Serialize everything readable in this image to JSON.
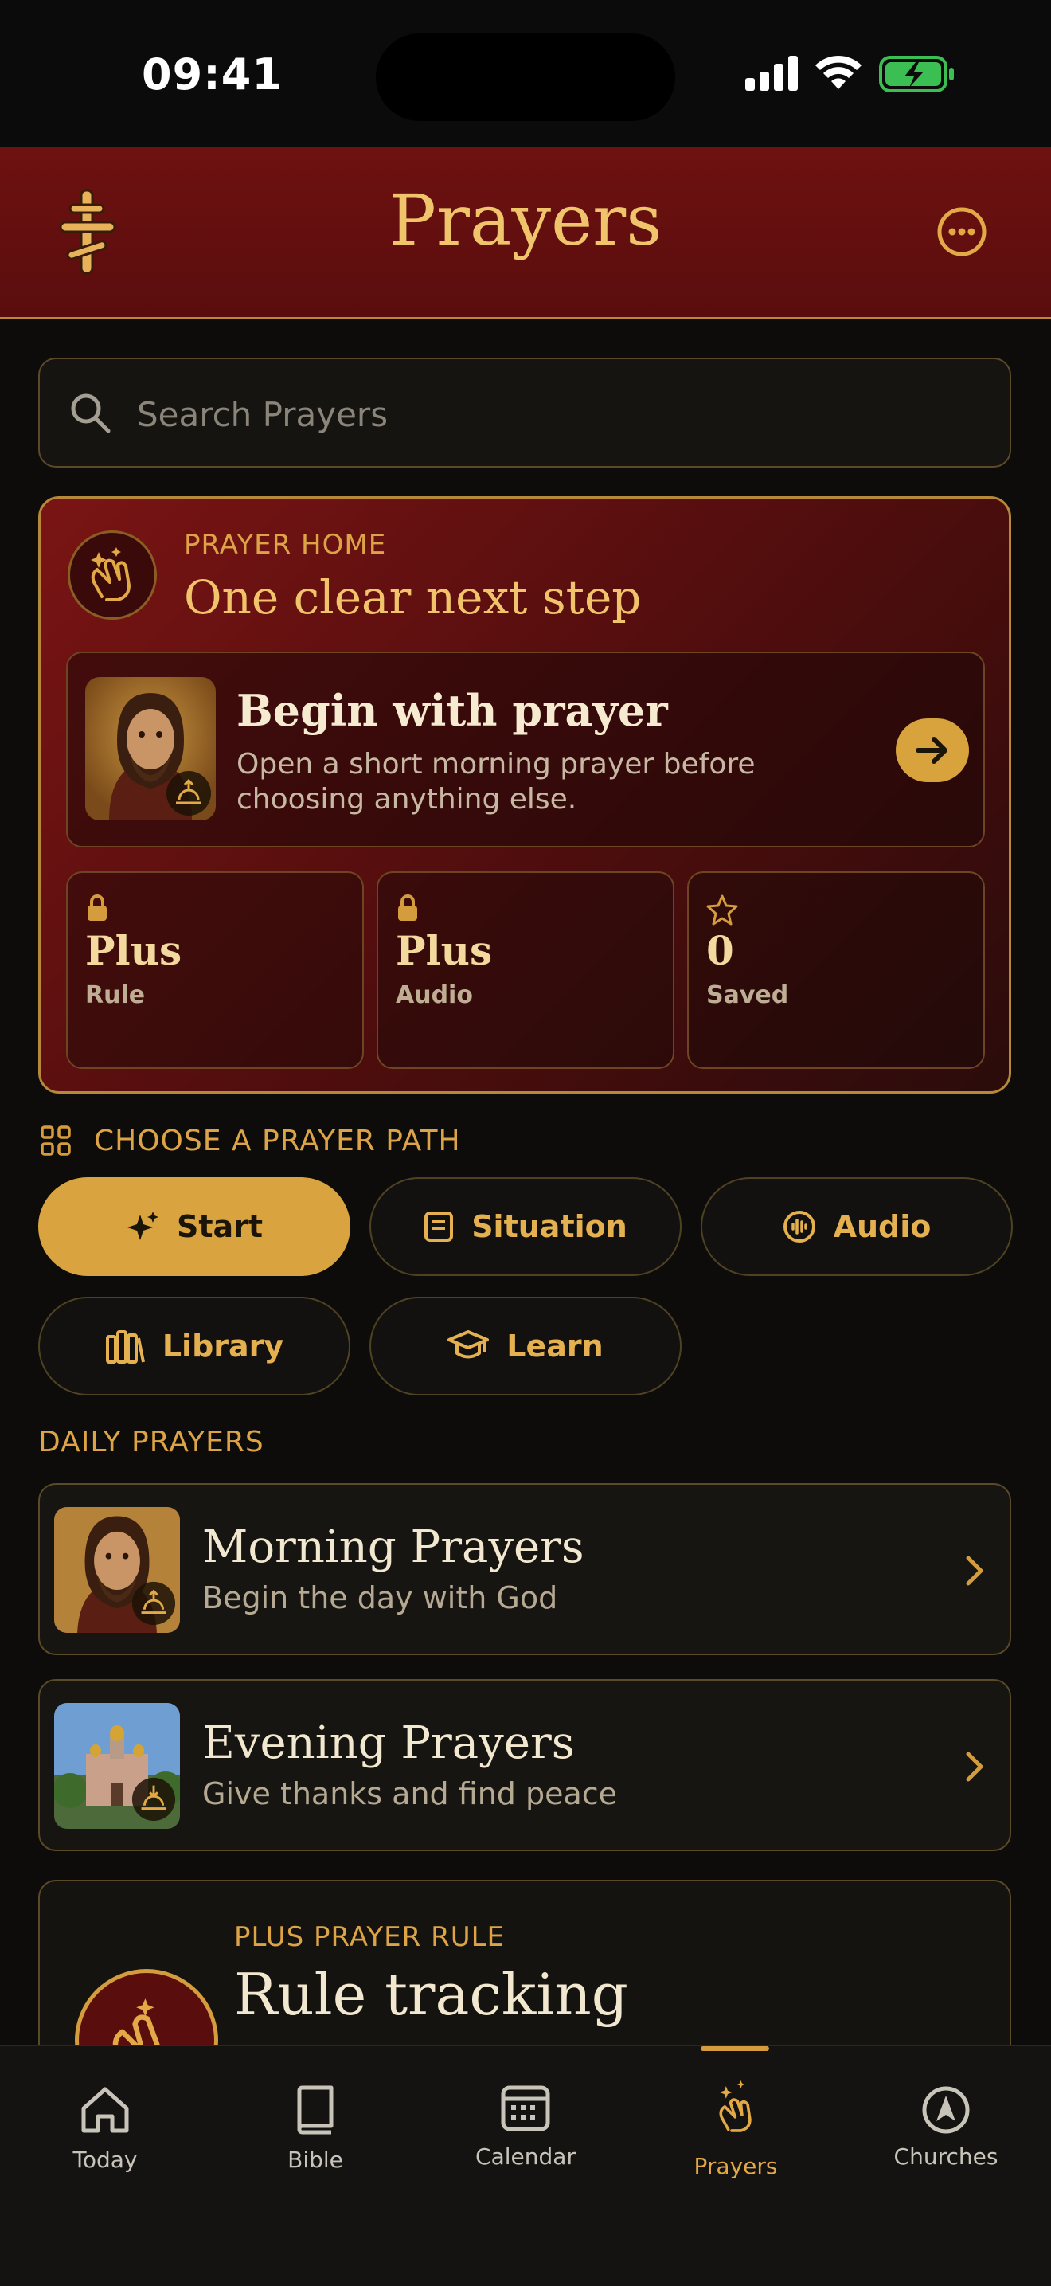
{
  "status_bar": {
    "time": "09:41"
  },
  "header": {
    "title": "Prayers"
  },
  "search": {
    "placeholder": "Search Prayers"
  },
  "prayer_home": {
    "eyebrow": "PRAYER HOME",
    "title": "One clear next step",
    "begin": {
      "title": "Begin with prayer",
      "subtitle": "Open a short morning prayer before choosing anything else."
    },
    "stats": [
      {
        "value": "Plus",
        "label": "Rule",
        "icon": "lock-icon"
      },
      {
        "value": "Plus",
        "label": "Audio",
        "icon": "lock-icon"
      },
      {
        "value": "0",
        "label": "Saved",
        "icon": "star-icon"
      }
    ]
  },
  "prayer_path": {
    "heading": "CHOOSE A PRAYER PATH",
    "options": [
      {
        "label": "Start",
        "icon": "sparkle-icon",
        "active": true
      },
      {
        "label": "Situation",
        "icon": "note-icon",
        "active": false
      },
      {
        "label": "Audio",
        "icon": "audio-icon",
        "active": false
      },
      {
        "label": "Library",
        "icon": "library-icon",
        "active": false
      },
      {
        "label": "Learn",
        "icon": "graduation-cap-icon",
        "active": false
      }
    ]
  },
  "daily_prayers": {
    "heading": "DAILY PRAYERS",
    "items": [
      {
        "title": "Morning Prayers",
        "subtitle": "Begin the day with God"
      },
      {
        "title": "Evening Prayers",
        "subtitle": "Give thanks and find peace"
      }
    ]
  },
  "plus_rule": {
    "eyebrow": "PLUS PRAYER RULE",
    "title": "Rule tracking"
  },
  "tabs": [
    {
      "label": "Today",
      "icon": "home-icon"
    },
    {
      "label": "Bible",
      "icon": "book-icon"
    },
    {
      "label": "Calendar",
      "icon": "calendar-icon"
    },
    {
      "label": "Prayers",
      "icon": "praying-hands-icon",
      "active": true
    },
    {
      "label": "Churches",
      "icon": "compass-icon"
    }
  ],
  "colors": {
    "accent": "#d9a43f",
    "header_red": "#6e1111",
    "background": "#0d0c0b"
  }
}
